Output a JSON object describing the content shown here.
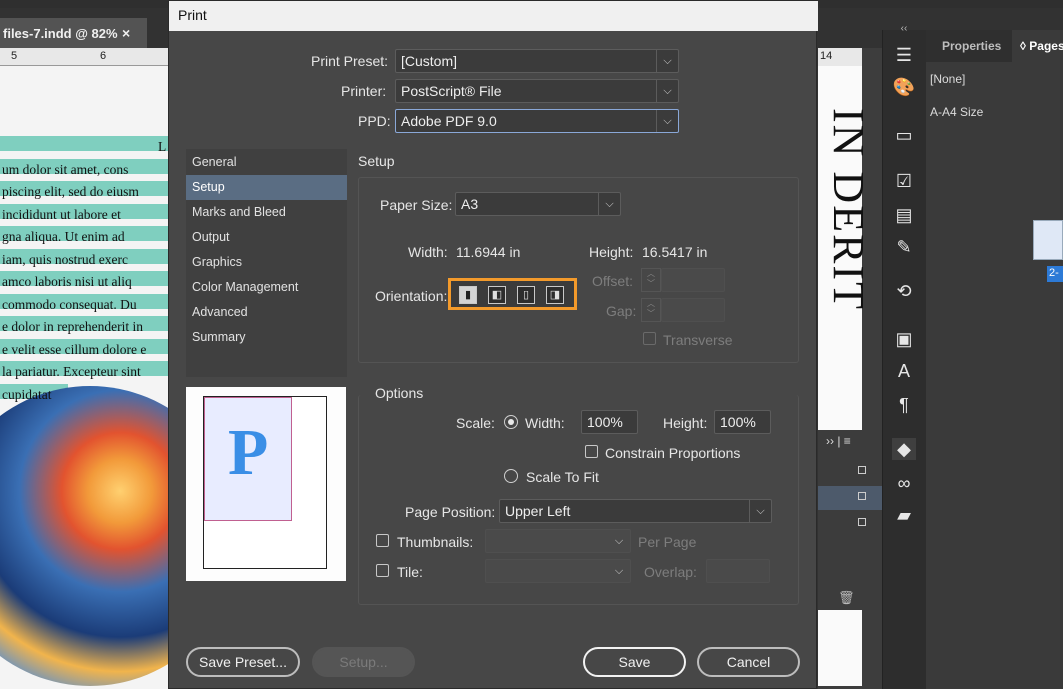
{
  "document": {
    "tab_title": "files-7.indd @ 82%",
    "close_glyph": "×",
    "ruler_ticks": [
      "5",
      "6"
    ],
    "ruler_right": "14",
    "body_lines": [
      "L",
      "um dolor sit amet, cons",
      "piscing elit, sed do eiusm",
      " incididunt ut labore et",
      "gna aliqua. Ut enim ad",
      "iam, quis nostrud exerc",
      "amco laboris nisi ut aliq",
      " commodo consequat. Du",
      "e dolor in reprehenderit in",
      "e velit esse cillum dolore e",
      "la pariatur. Excepteur sint",
      " cupidatat"
    ],
    "vertical_heading": "IN DERIT"
  },
  "properties_panel": {
    "tab_properties": "Properties",
    "tab_pages": "◊ Pages",
    "master_label": "[None]",
    "size_label": "A-A4 Size",
    "page_badge": "2-"
  },
  "dialog": {
    "title": "Print",
    "print_preset_label": "Print Preset:",
    "print_preset_value": "[Custom]",
    "printer_label": "Printer:",
    "printer_value": "PostScript® File",
    "ppd_label": "PPD:",
    "ppd_value": "Adobe PDF 9.0",
    "nav_items": [
      "General",
      "Setup",
      "Marks and Bleed",
      "Output",
      "Graphics",
      "Color Management",
      "Advanced",
      "Summary"
    ],
    "active_nav": "Setup",
    "preview_letter": "P",
    "setup": {
      "heading": "Setup",
      "paper_size_label": "Paper Size:",
      "paper_size_value": "A3",
      "width_label": "Width:",
      "width_value": "11.6944 in",
      "height_label": "Height:",
      "height_value": "16.5417 in",
      "orientation_label": "Orientation:",
      "orientation_icons": [
        "portrait-icon",
        "landscape-icon",
        "reverse-portrait-icon",
        "reverse-landscape-icon"
      ],
      "offset_label": "Offset:",
      "gap_label": "Gap:",
      "transverse_label": "Transverse"
    },
    "options": {
      "heading": "Options",
      "scale_label": "Scale:",
      "scale_width_label": "Width:",
      "scale_width_value": "100%",
      "scale_height_label": "Height:",
      "scale_height_value": "100%",
      "constrain_label": "Constrain Proportions",
      "scale_to_fit_label": "Scale To Fit",
      "page_position_label": "Page Position:",
      "page_position_value": "Upper Left",
      "thumbnails_label": "Thumbnails:",
      "per_page_label": "Per Page",
      "tile_label": "Tile:",
      "overlap_label": "Overlap:"
    },
    "buttons": {
      "save_preset": "Save Preset...",
      "setup": "Setup...",
      "save": "Save",
      "cancel": "Cancel"
    }
  },
  "colors": {
    "highlight": "#7fcfbf",
    "orientation_border": "#f39a2b",
    "nav_active": "#5a6d83"
  }
}
